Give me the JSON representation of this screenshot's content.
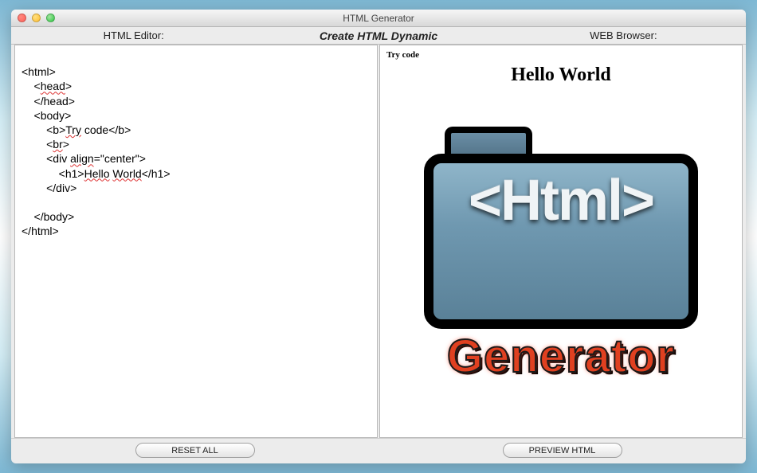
{
  "window": {
    "title": "HTML Generator"
  },
  "header": {
    "left_label": "HTML Editor:",
    "center_label": "Create HTML Dynamic",
    "right_label": "WEB Browser:"
  },
  "editor": {
    "line_blank": " ",
    "line1": "<html>",
    "line2_indent": "    <",
    "line2_word": "head",
    "line2_close": ">",
    "line3": "    </head>",
    "line4": "    <body>",
    "line5_a": "        <b>",
    "line5_word": "Try",
    "line5_b": " code</b>",
    "line6_a": "        <",
    "line6_word": "br",
    "line6_b": ">",
    "line7_a": "        <div ",
    "line7_word": "align",
    "line7_b": "=\"center\">",
    "line8_a": "            <h1>",
    "line8_word1": "Hello",
    "line8_mid": " ",
    "line8_word2": "World",
    "line8_b": "</h1>",
    "line9": "        </div>",
    "line10": " ",
    "line11": "    </body>",
    "line12": "</html>"
  },
  "preview": {
    "bold_text": "Try code",
    "heading_text": "Hello World",
    "icon_html_text": "<Html>",
    "icon_generator_text": "Generator"
  },
  "buttons": {
    "reset": "RESET ALL",
    "preview": "PREVIEW HTML"
  }
}
